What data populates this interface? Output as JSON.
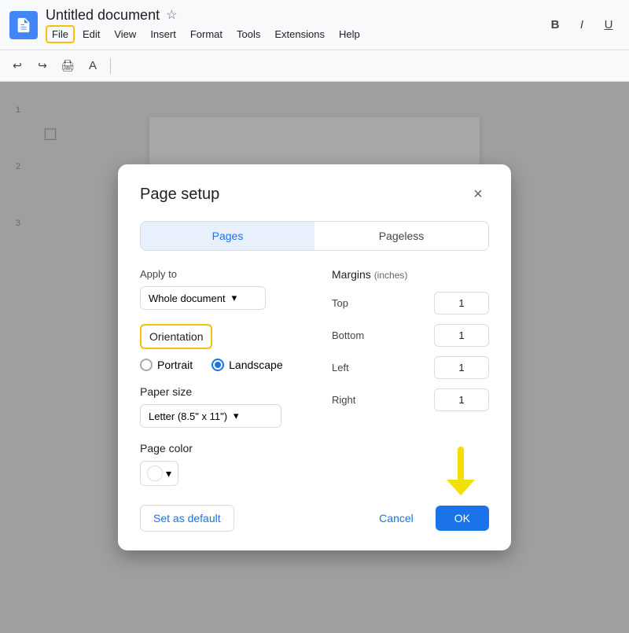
{
  "app": {
    "title": "Untitled document",
    "icon_label": "docs-icon"
  },
  "menubar": {
    "items": [
      {
        "id": "file",
        "label": "File",
        "highlighted": true
      },
      {
        "id": "edit",
        "label": "Edit",
        "highlighted": false
      },
      {
        "id": "view",
        "label": "View",
        "highlighted": false
      },
      {
        "id": "insert",
        "label": "Insert",
        "highlighted": false
      },
      {
        "id": "format",
        "label": "Format",
        "highlighted": false
      },
      {
        "id": "tools",
        "label": "Tools",
        "highlighted": false
      },
      {
        "id": "extensions",
        "label": "Extensions",
        "highlighted": false
      },
      {
        "id": "help",
        "label": "Help",
        "highlighted": false
      }
    ]
  },
  "toolbar": {
    "undo": "↩",
    "redo": "↪",
    "bold": "B",
    "italic": "I",
    "underline": "U"
  },
  "dialog": {
    "title": "Page setup",
    "close_label": "×",
    "tabs": [
      {
        "id": "pages",
        "label": "Pages",
        "active": true
      },
      {
        "id": "pageless",
        "label": "Pageless",
        "active": false
      }
    ],
    "apply_to": {
      "label": "Apply to",
      "value": "Whole document",
      "arrow": "▾"
    },
    "orientation": {
      "label": "Orientation",
      "options": [
        {
          "id": "portrait",
          "label": "Portrait",
          "selected": false
        },
        {
          "id": "landscape",
          "label": "Landscape",
          "selected": true
        }
      ]
    },
    "paper_size": {
      "label": "Paper size",
      "value": "Letter (8.5\" x 11\")",
      "arrow": "▾"
    },
    "page_color": {
      "label": "Page color",
      "arrow": "▾"
    },
    "margins": {
      "label": "Margins",
      "unit": "(inches)",
      "fields": [
        {
          "id": "top",
          "label": "Top",
          "value": "1"
        },
        {
          "id": "bottom",
          "label": "Bottom",
          "value": "1"
        },
        {
          "id": "left",
          "label": "Left",
          "value": "1"
        },
        {
          "id": "right",
          "label": "Right",
          "value": "1"
        }
      ]
    },
    "footer": {
      "set_default": "Set as default",
      "cancel": "Cancel",
      "ok": "OK"
    }
  },
  "colors": {
    "accent_blue": "#1a73e8",
    "highlight_yellow": "#f4c20d",
    "tab_active_bg": "#e8f0fe",
    "tab_active_text": "#1a73e8"
  }
}
